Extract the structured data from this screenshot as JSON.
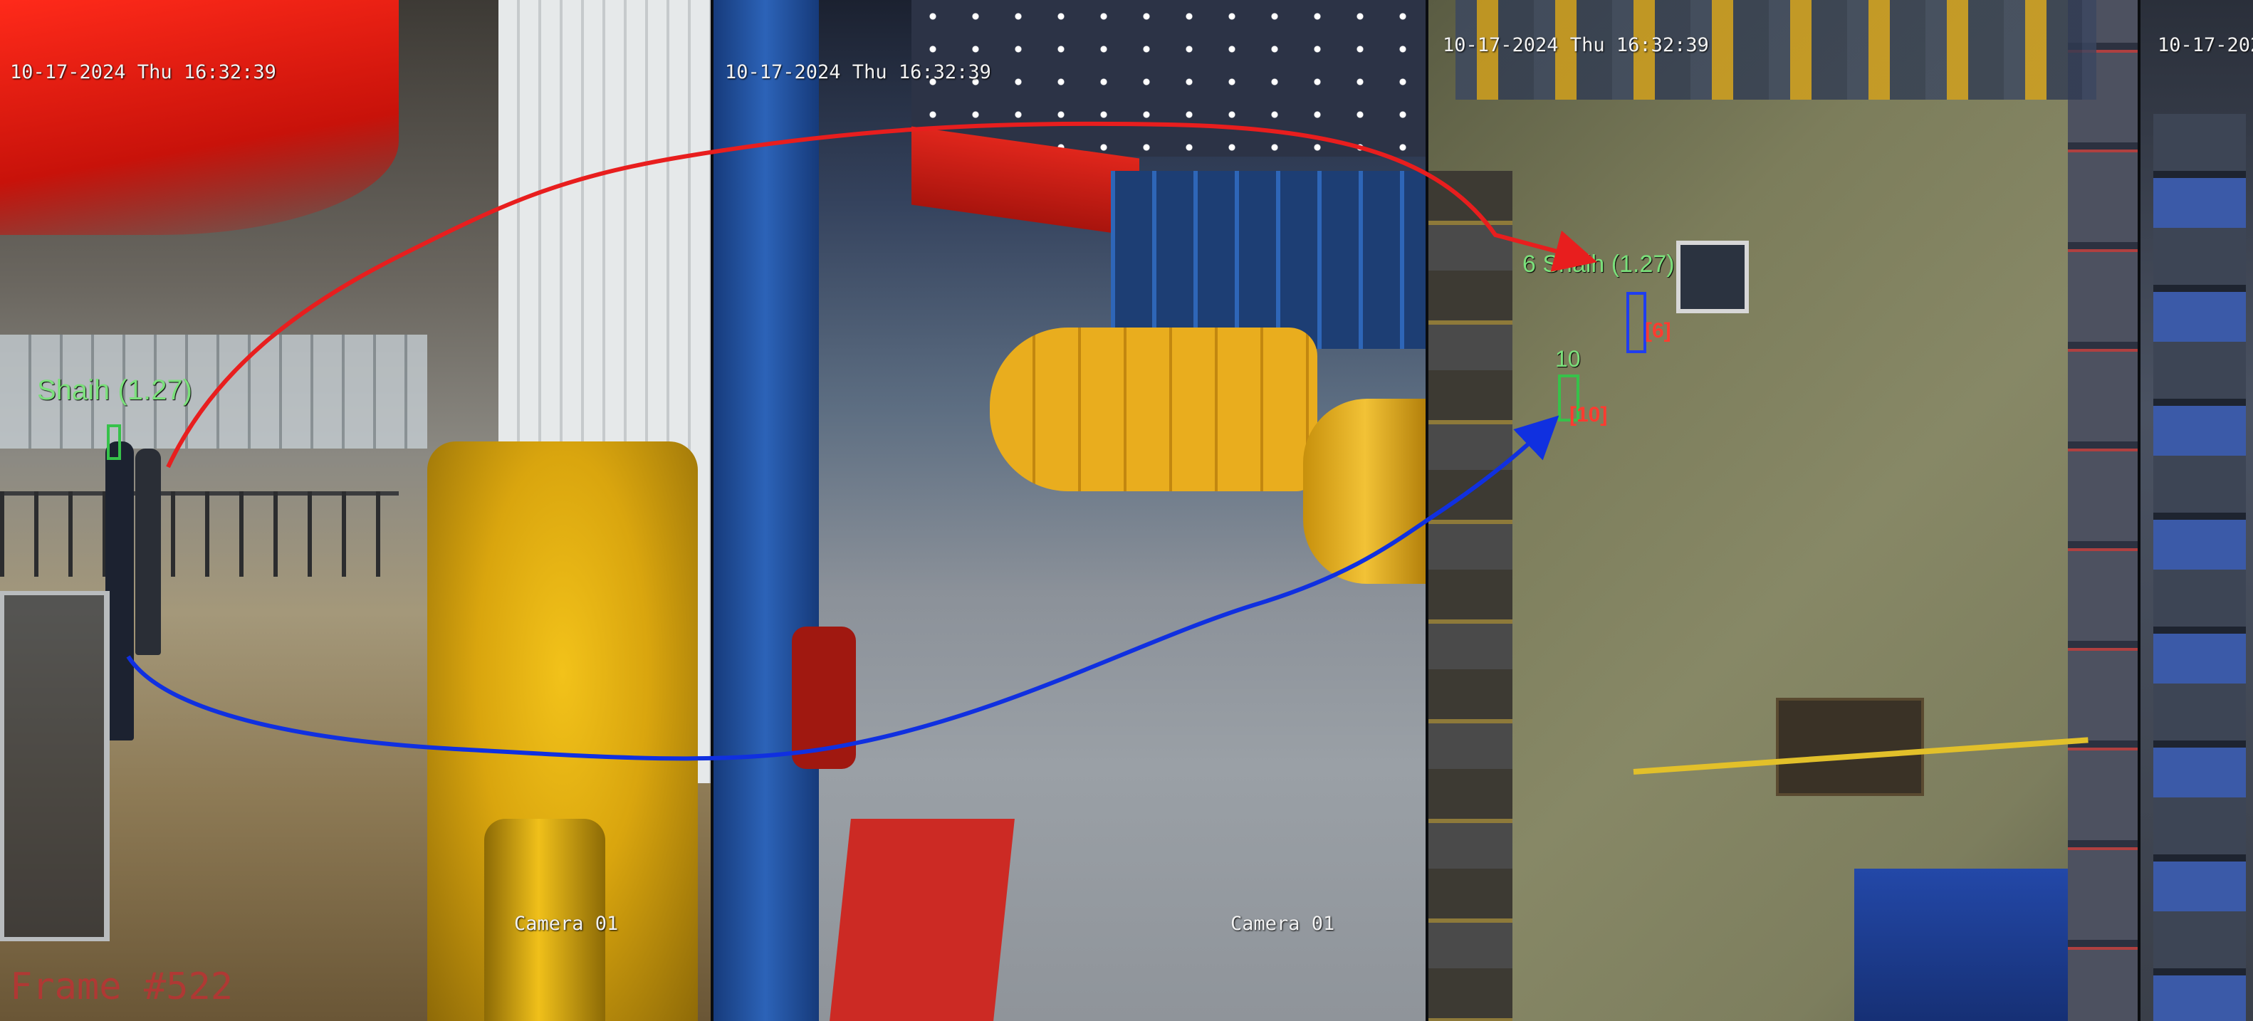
{
  "cameras": [
    {
      "timestamp": "10-17-2024 Thu 16:32:39",
      "caption": "Camera 01"
    },
    {
      "timestamp": "10-17-2024 Thu 16:32:39",
      "caption": "Camera 01"
    },
    {
      "timestamp": "10-17-2024 Thu 16:32:39",
      "caption": ""
    },
    {
      "timestamp": "10-17-2024",
      "caption": ""
    }
  ],
  "tracks": [
    {
      "label": "Shaih (1.27)",
      "color": "#7be07b"
    },
    {
      "label": "6 Shaih (1.27)",
      "id_tag": "[6]",
      "color": "#7be07b"
    },
    {
      "label": "10",
      "id_tag": "[10]",
      "color": "#7be07b"
    }
  ],
  "frame_counter": "Frame #522",
  "colors": {
    "red_track": "#e81e1e",
    "blue_track": "#1030e0",
    "box_green": "#36c24a",
    "box_blue": "#1f3df0",
    "tag_red": "#ff3b30"
  }
}
